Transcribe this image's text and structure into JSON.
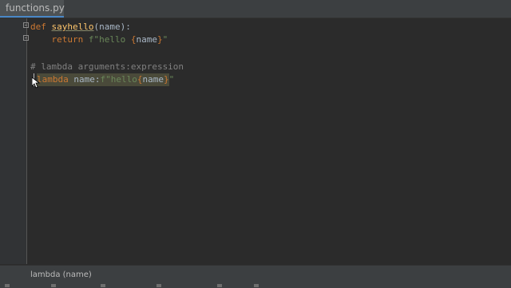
{
  "tab": {
    "label": "functions.py",
    "icon": "python-file-icon"
  },
  "code": {
    "line1": {
      "kw": "def",
      "fn": "sayhello",
      "rest": "(name):"
    },
    "line2": {
      "kw": "return",
      "str1": "f\"hello ",
      "brace_open": "{",
      "name": "name",
      "brace_close": "}",
      "str2": "\""
    },
    "line4": {
      "comment": "# lambda arguments:expression"
    },
    "line5": {
      "kw": "lambda",
      "mid": " name:",
      "str1": "f\"hello",
      "brace_open": "{",
      "name": "name",
      "brace_close": "}",
      "str2": "\""
    }
  },
  "status": {
    "hint": "lambda (name)"
  },
  "colors": {
    "background": "#2b2b2b",
    "keyword": "#cc7832",
    "function": "#ffc66d",
    "string": "#6a8759",
    "comment": "#808080",
    "text": "#a9b7c6"
  }
}
